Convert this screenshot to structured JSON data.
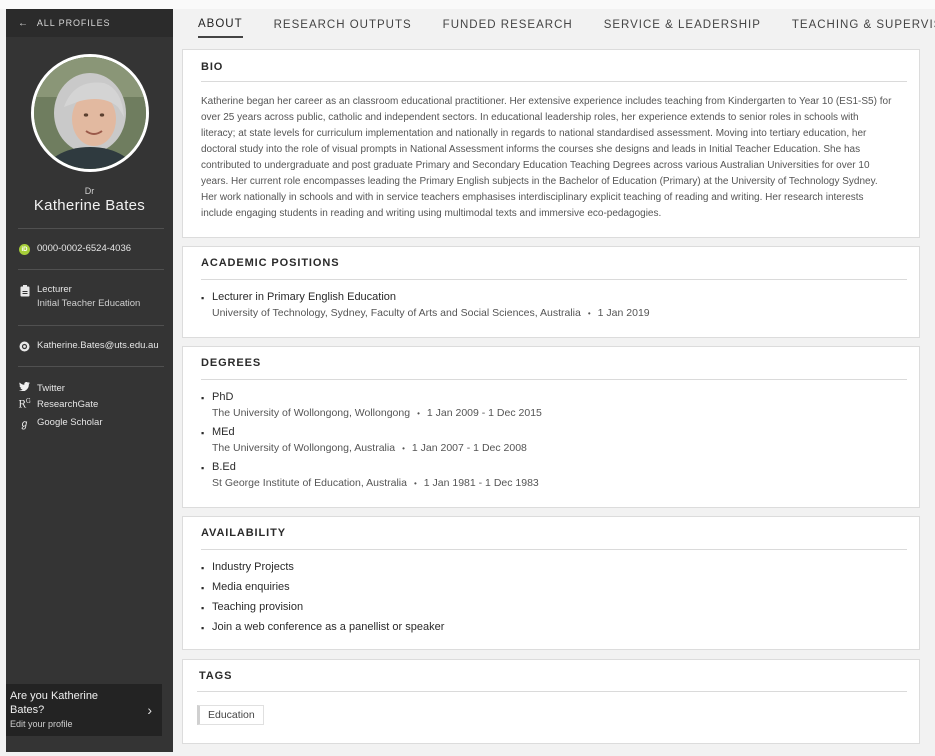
{
  "sidebar": {
    "back_label": "ALL PROFILES",
    "honorific": "Dr",
    "name": "Katherine Bates",
    "orcid": "0000-0002-6524-4036",
    "position_title": "Lecturer",
    "position_unit": "Initial Teacher Education",
    "email": "Katherine.Bates@uts.edu.au",
    "links": [
      {
        "label": "Twitter",
        "icon": "twitter-icon"
      },
      {
        "label": "ResearchGate",
        "icon": "researchgate-icon"
      },
      {
        "label": "Google Scholar",
        "icon": "google-scholar-icon"
      }
    ],
    "claim": {
      "title": "Are you Katherine Bates?",
      "subtitle": "Edit your profile"
    }
  },
  "tabs": [
    {
      "label": "ABOUT",
      "active": true
    },
    {
      "label": "RESEARCH OUTPUTS"
    },
    {
      "label": "FUNDED RESEARCH"
    },
    {
      "label": "SERVICE & LEADERSHIP"
    },
    {
      "label": "TEACHING & SUPERVISION"
    }
  ],
  "bio": {
    "title": "BIO",
    "text": "Katherine began her career as an classroom educational practitioner. Her extensive experience includes teaching from Kindergarten to Year 10 (ES1-S5) for over 25 years across public, catholic and independent sectors. In educational leadership roles, her experience extends to senior roles in schools with literacy; at state  levels for curriculum implementation and nationally in regards to national standardised assessment. Moving into tertiary education, her doctoral study into the role of visual prompts in National Assessment informs the courses she designs and leads in Initial Teacher Education. She has contributed to undergraduate and post graduate Primary and Secondary Education Teaching Degrees across various Australian Universities for over 10 years. Her current role encompasses leading the Primary English subjects in the  Bachelor of Education (Primary) at the University of Technology Sydney.  Her work nationally in schools and with in service teachers emphasises interdisciplinary explicit teaching of reading and writing. Her research interests include engaging students in reading and writing using multimodal texts and immersive eco-pedagogies."
  },
  "academic_positions": {
    "title": "ACADEMIC POSITIONS",
    "items": [
      {
        "role": "Lecturer in Primary English Education",
        "org": "University of Technology, Sydney, Faculty of Arts and Social Sciences, Australia",
        "date": "1 Jan 2019"
      }
    ]
  },
  "degrees": {
    "title": "DEGREES",
    "items": [
      {
        "name": "PhD",
        "org": "The University of Wollongong, Wollongong",
        "date": "1 Jan 2009 - 1 Dec 2015"
      },
      {
        "name": "MEd",
        "org": "The University of Wollongong, Australia",
        "date": "1 Jan 2007 - 1 Dec 2008"
      },
      {
        "name": "B.Ed",
        "org": "St George Institute of Education, Australia",
        "date": "1 Jan 1981 - 1 Dec 1983"
      }
    ]
  },
  "availability": {
    "title": "AVAILABILITY",
    "items": [
      "Industry Projects",
      "Media enquiries",
      "Teaching provision",
      "Join a web conference as a panellist or speaker"
    ]
  },
  "tags": {
    "title": "TAGS",
    "items": [
      "Education"
    ]
  }
}
